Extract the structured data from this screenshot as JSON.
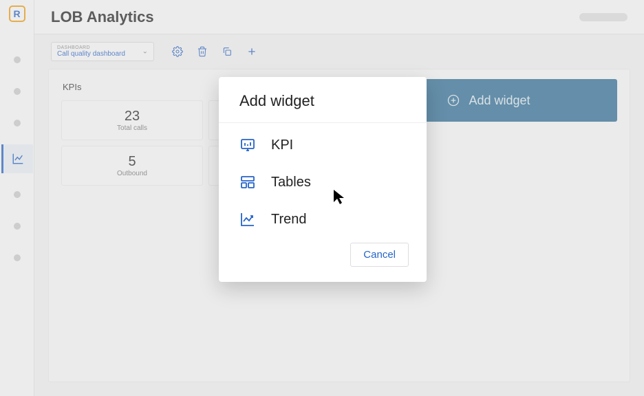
{
  "page_title": "LOB Analytics",
  "dashboard_selector": {
    "label": "DASHBOARD",
    "value": "Call quality dashboard"
  },
  "kpi_panel": {
    "title": "KPIs",
    "cards": [
      {
        "value": "23",
        "label": "Total calls"
      },
      {
        "value": "",
        "label": ""
      },
      {
        "value": "5",
        "label": "Outbound"
      },
      {
        "value": "",
        "label": ""
      }
    ]
  },
  "add_widget_button": "Add widget",
  "modal": {
    "title": "Add widget",
    "options": [
      {
        "icon": "kpi-icon",
        "label": "KPI"
      },
      {
        "icon": "table-icon",
        "label": "Tables"
      },
      {
        "icon": "trend-icon",
        "label": "Trend"
      }
    ],
    "cancel": "Cancel"
  }
}
